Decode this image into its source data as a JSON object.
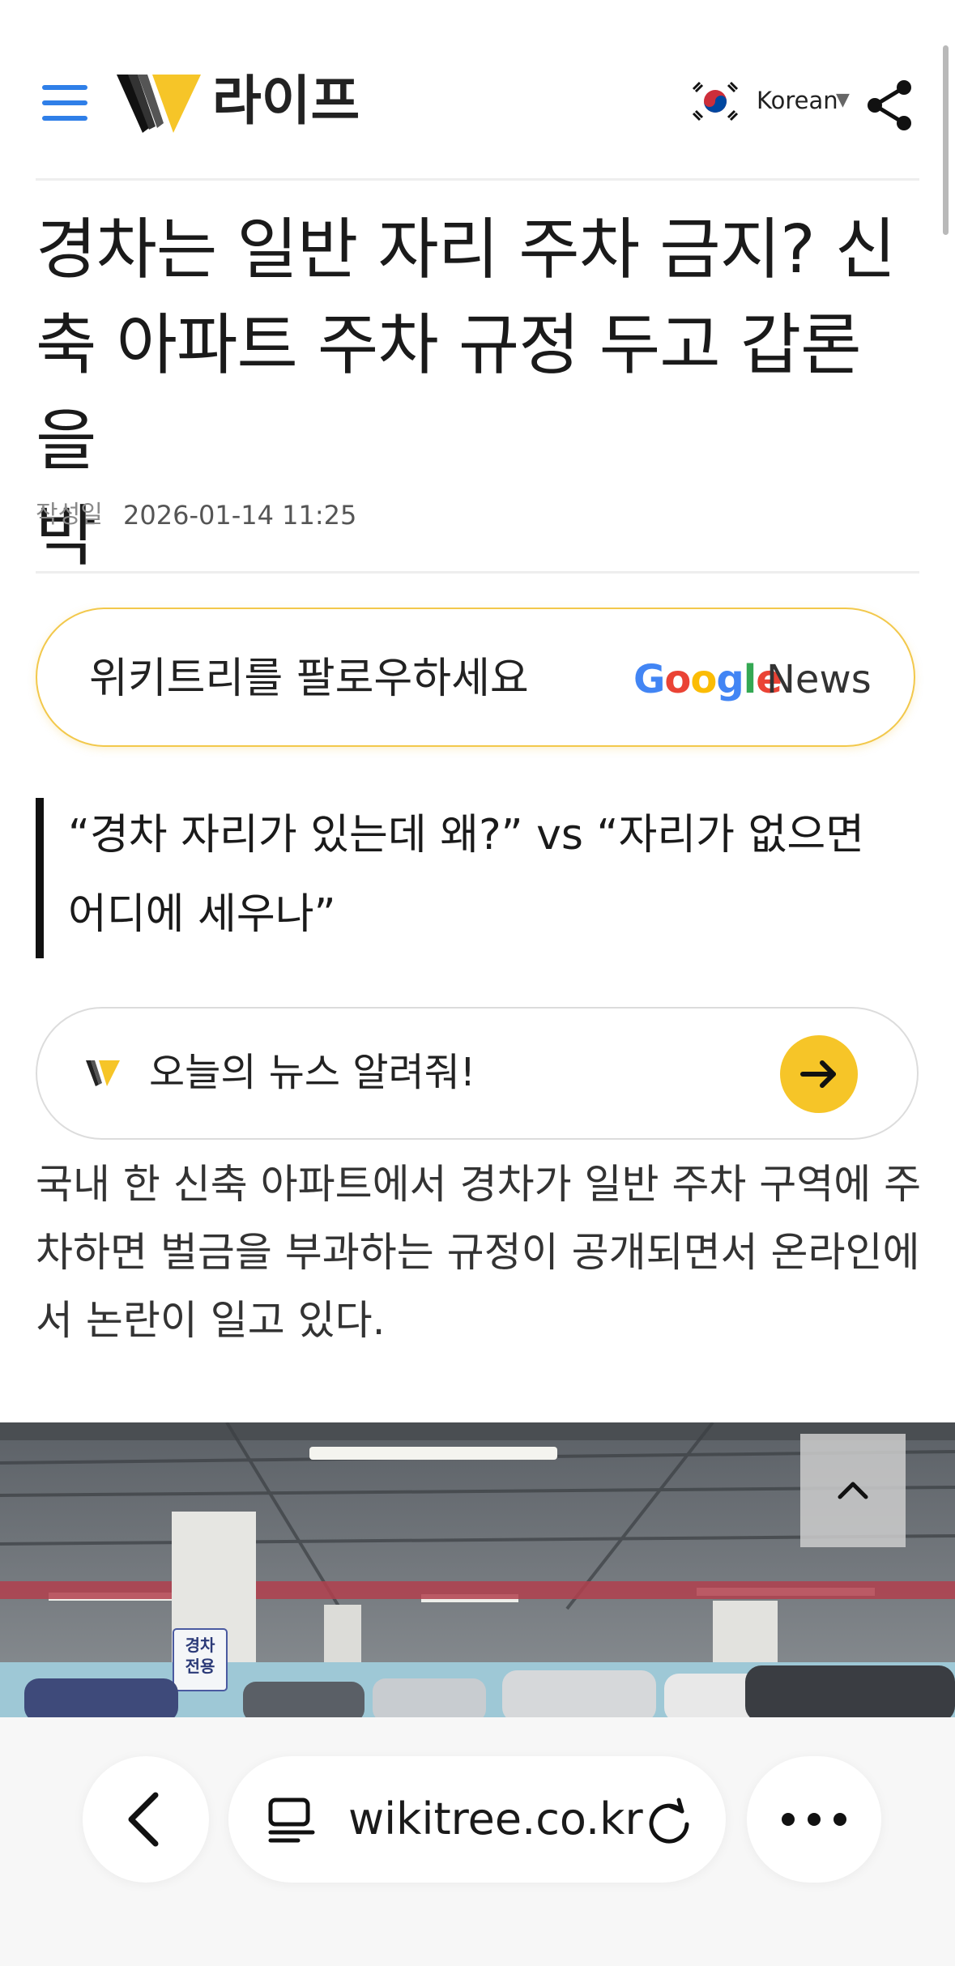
{
  "header": {
    "section_title": "라이프",
    "language": "Korean",
    "icons": {
      "menu": "menu-icon",
      "logo": "wikitree-logo",
      "flag": "korea-flag-icon",
      "share": "share-icon"
    }
  },
  "article": {
    "headline_line1": "경차는 일반 자리 주차 금지? 신",
    "headline_line2": "축 아파트 주차 규정 두고 갑론을",
    "headline_line3": "박",
    "meta_label": "작성일",
    "date": "2026-01-14 11:25",
    "quote_line1": "“경차 자리가 있는데 왜?” vs “자리가 없으면",
    "quote_line2": "어디에 세우나”",
    "body_line1": "국내 한 신축 아파트에서 경차가 일반 주차 구역에 주",
    "body_line2": "차하면 벌금을 부과하는 규정이 공개되면서 온라인에",
    "body_line3": "서 논란이 일고 있다.",
    "photo_sign": "경차 전용"
  },
  "follow": {
    "text": "위키트리를 팔로우하세요",
    "google": [
      "G",
      "o",
      "o",
      "g",
      "l",
      "e"
    ],
    "news": "News"
  },
  "ask": {
    "text": "오늘의 뉴스 알려줘!"
  },
  "browser": {
    "url": "wikitree.co.kr"
  },
  "colors": {
    "accent_blue": "#2f7fe8",
    "brand_yellow": "#f6c528",
    "pill_border": "#f2c84b",
    "google_blue": "#4285f4",
    "google_red": "#ea4335",
    "google_yellow": "#fbbc05",
    "google_green": "#34a853"
  }
}
